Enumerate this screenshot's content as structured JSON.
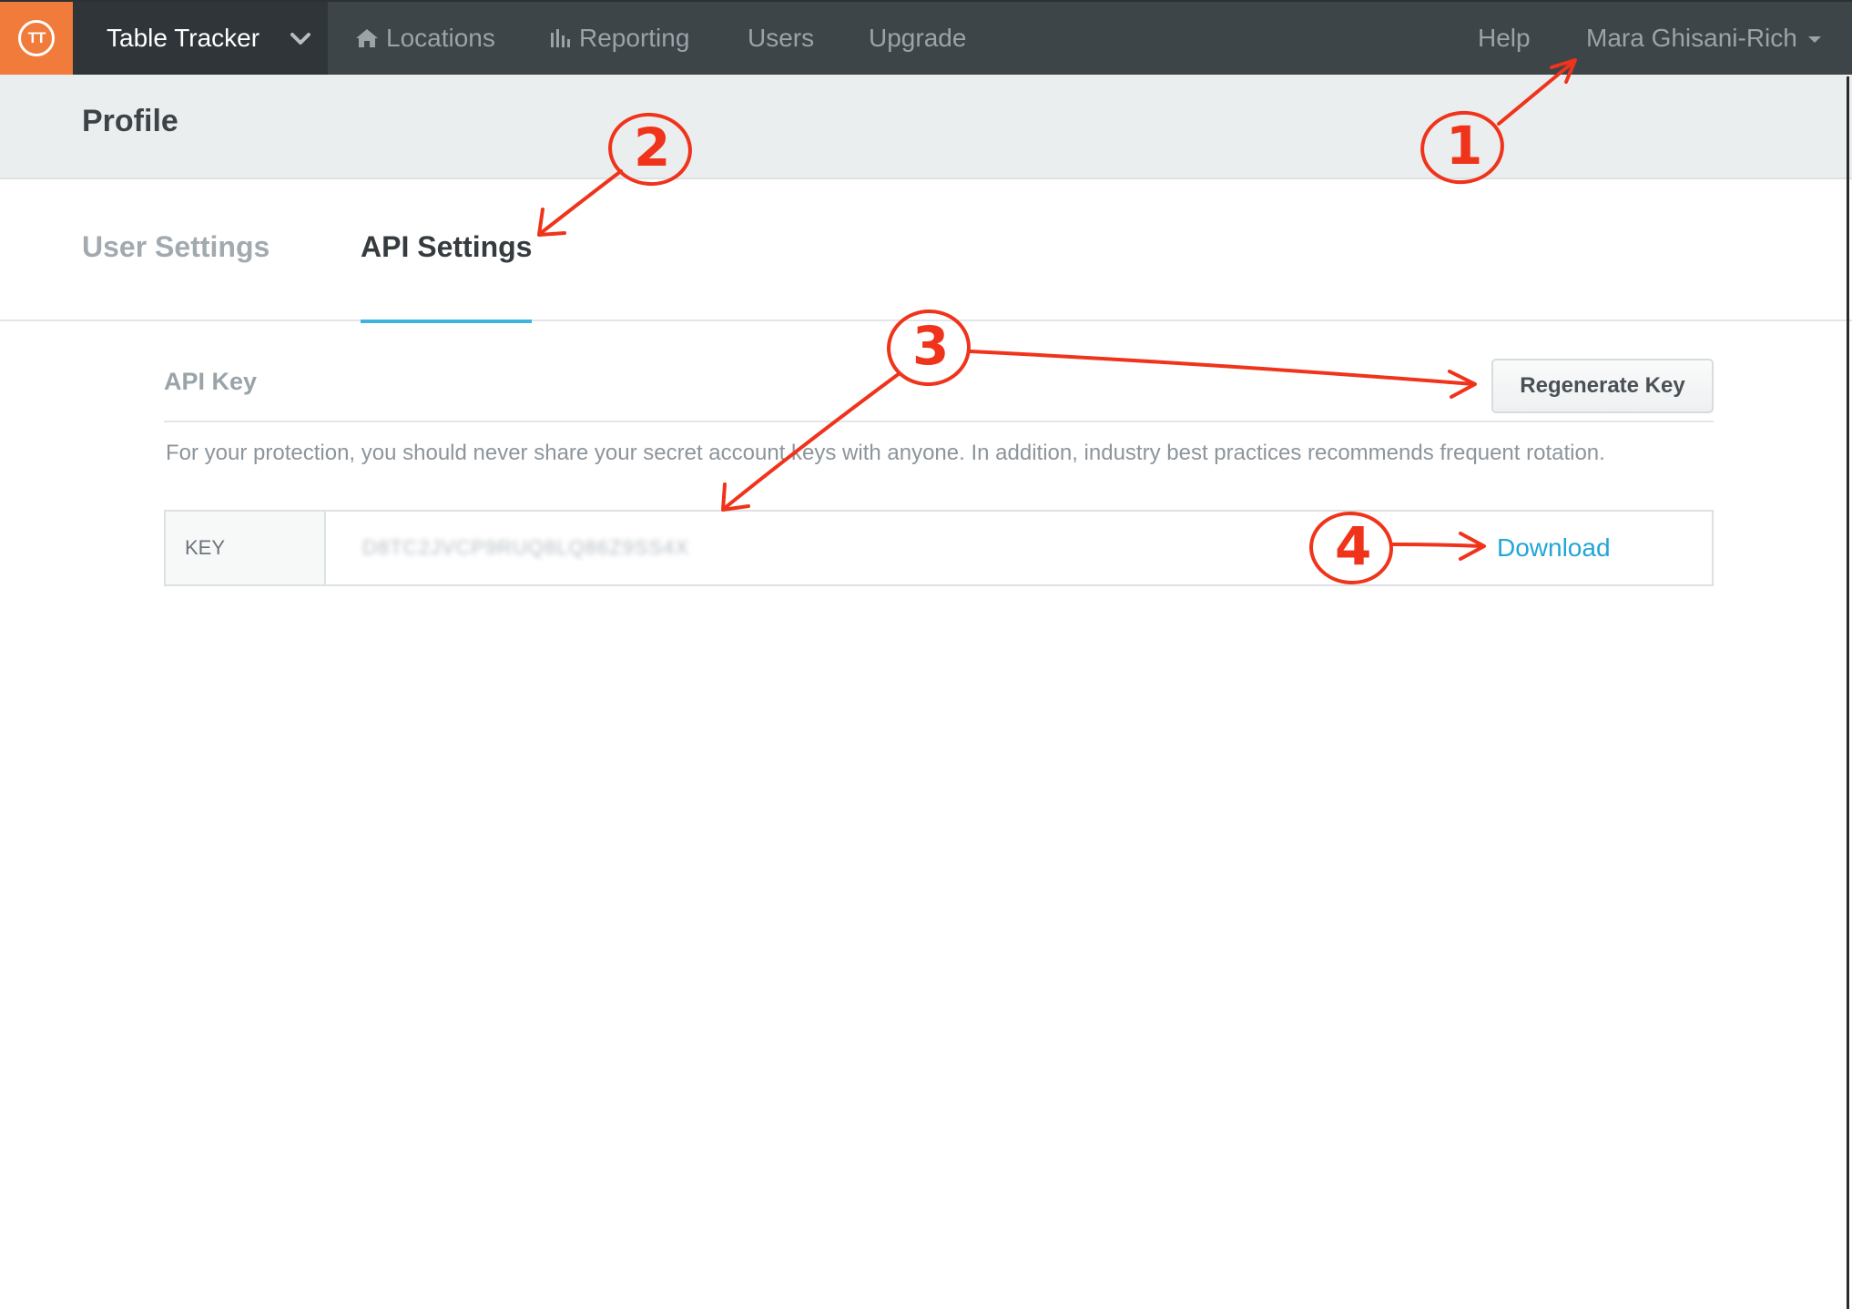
{
  "brand": {
    "logo_text": "TT",
    "app_name": "Table Tracker",
    "accent": "#f07b3b"
  },
  "nav": {
    "items": [
      {
        "label": "Locations",
        "icon": "home-icon"
      },
      {
        "label": "Reporting",
        "icon": "bar-chart-icon"
      },
      {
        "label": "Users"
      },
      {
        "label": "Upgrade"
      }
    ],
    "help": "Help",
    "user": "Mara Ghisani-Rich"
  },
  "page": {
    "title": "Profile"
  },
  "tabs": [
    {
      "label": "User Settings",
      "active": false
    },
    {
      "label": "API Settings",
      "active": true
    }
  ],
  "api": {
    "section_label": "API Key",
    "regenerate_label": "Regenerate Key",
    "help_text": "For your protection, you should never share your secret account keys with anyone. In addition, industry best practices recommends frequent rotation.",
    "key_label": "KEY",
    "key_value": "D8TC2JVCP9RUQ8LQ86Z9SS4X",
    "download_label": "Download",
    "link_color": "#22a6d6"
  },
  "annotations": [
    "1",
    "2",
    "3",
    "4"
  ]
}
